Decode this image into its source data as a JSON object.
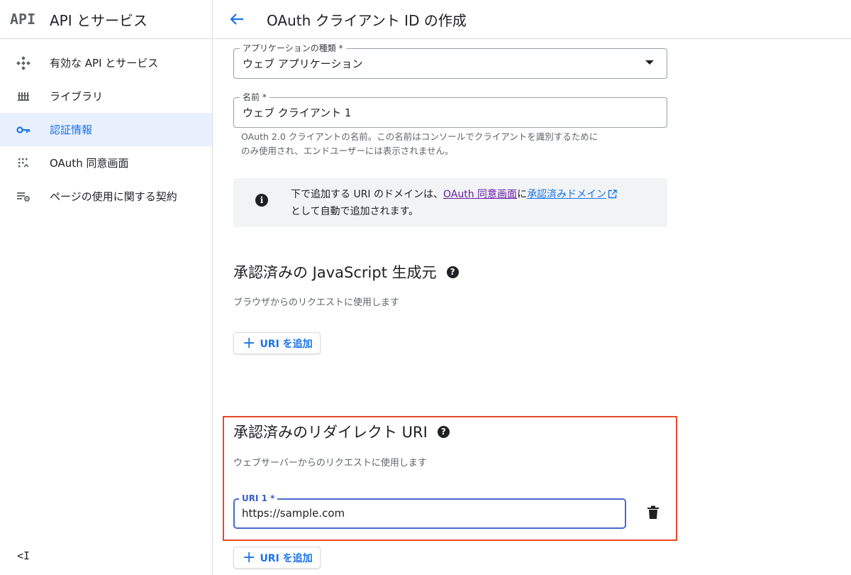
{
  "sidebar": {
    "logo": "API",
    "title": "API とサービス",
    "items": [
      {
        "label": "有効な API とサービス",
        "icon": "api-diamond-icon",
        "active": false
      },
      {
        "label": "ライブラリ",
        "icon": "library-icon",
        "active": false
      },
      {
        "label": "認証情報",
        "icon": "key-icon",
        "active": true
      },
      {
        "label": "OAuth 同意画面",
        "icon": "consent-grid-icon",
        "active": false
      },
      {
        "label": "ページの使用に関する契約",
        "icon": "page-settings-icon",
        "active": false
      }
    ],
    "collapse_label": "<I"
  },
  "header": {
    "title": "OAuth クライアント ID の作成"
  },
  "form": {
    "app_type": {
      "label": "アプリケーションの種類 *",
      "value": "ウェブ アプリケーション"
    },
    "name": {
      "label": "名前 *",
      "value": "ウェブ クライアント 1"
    },
    "name_hint_line1": "OAuth 2.0 クライアントの名前。この名前はコンソールでクライアントを識別するために",
    "name_hint_line2": "のみ使用され、エンドユーザーには表示されません。"
  },
  "info": {
    "text_before": "下で追加する URI のドメインは、",
    "link1": "OAuth 同意画面",
    "text_middle": "に",
    "link2": "承認済みドメイン",
    "text_after": "として自動で追加されます。"
  },
  "js_origins": {
    "title": "承認済みの JavaScript 生成元",
    "desc": "ブラウザからのリクエストに使用します",
    "add_label": "URI を追加"
  },
  "redirect_uris": {
    "title": "承認済みのリダイレクト URI",
    "desc": "ウェブサーバーからのリクエストに使用します",
    "uri1_label": "URI 1 *",
    "uri1_value": "https://sample.com",
    "add_label": "URI を追加"
  },
  "colors": {
    "accent": "#1a73e8",
    "active_bg": "#e8f0fe",
    "highlight": "#e8472b",
    "link_visited": "#681da8"
  }
}
